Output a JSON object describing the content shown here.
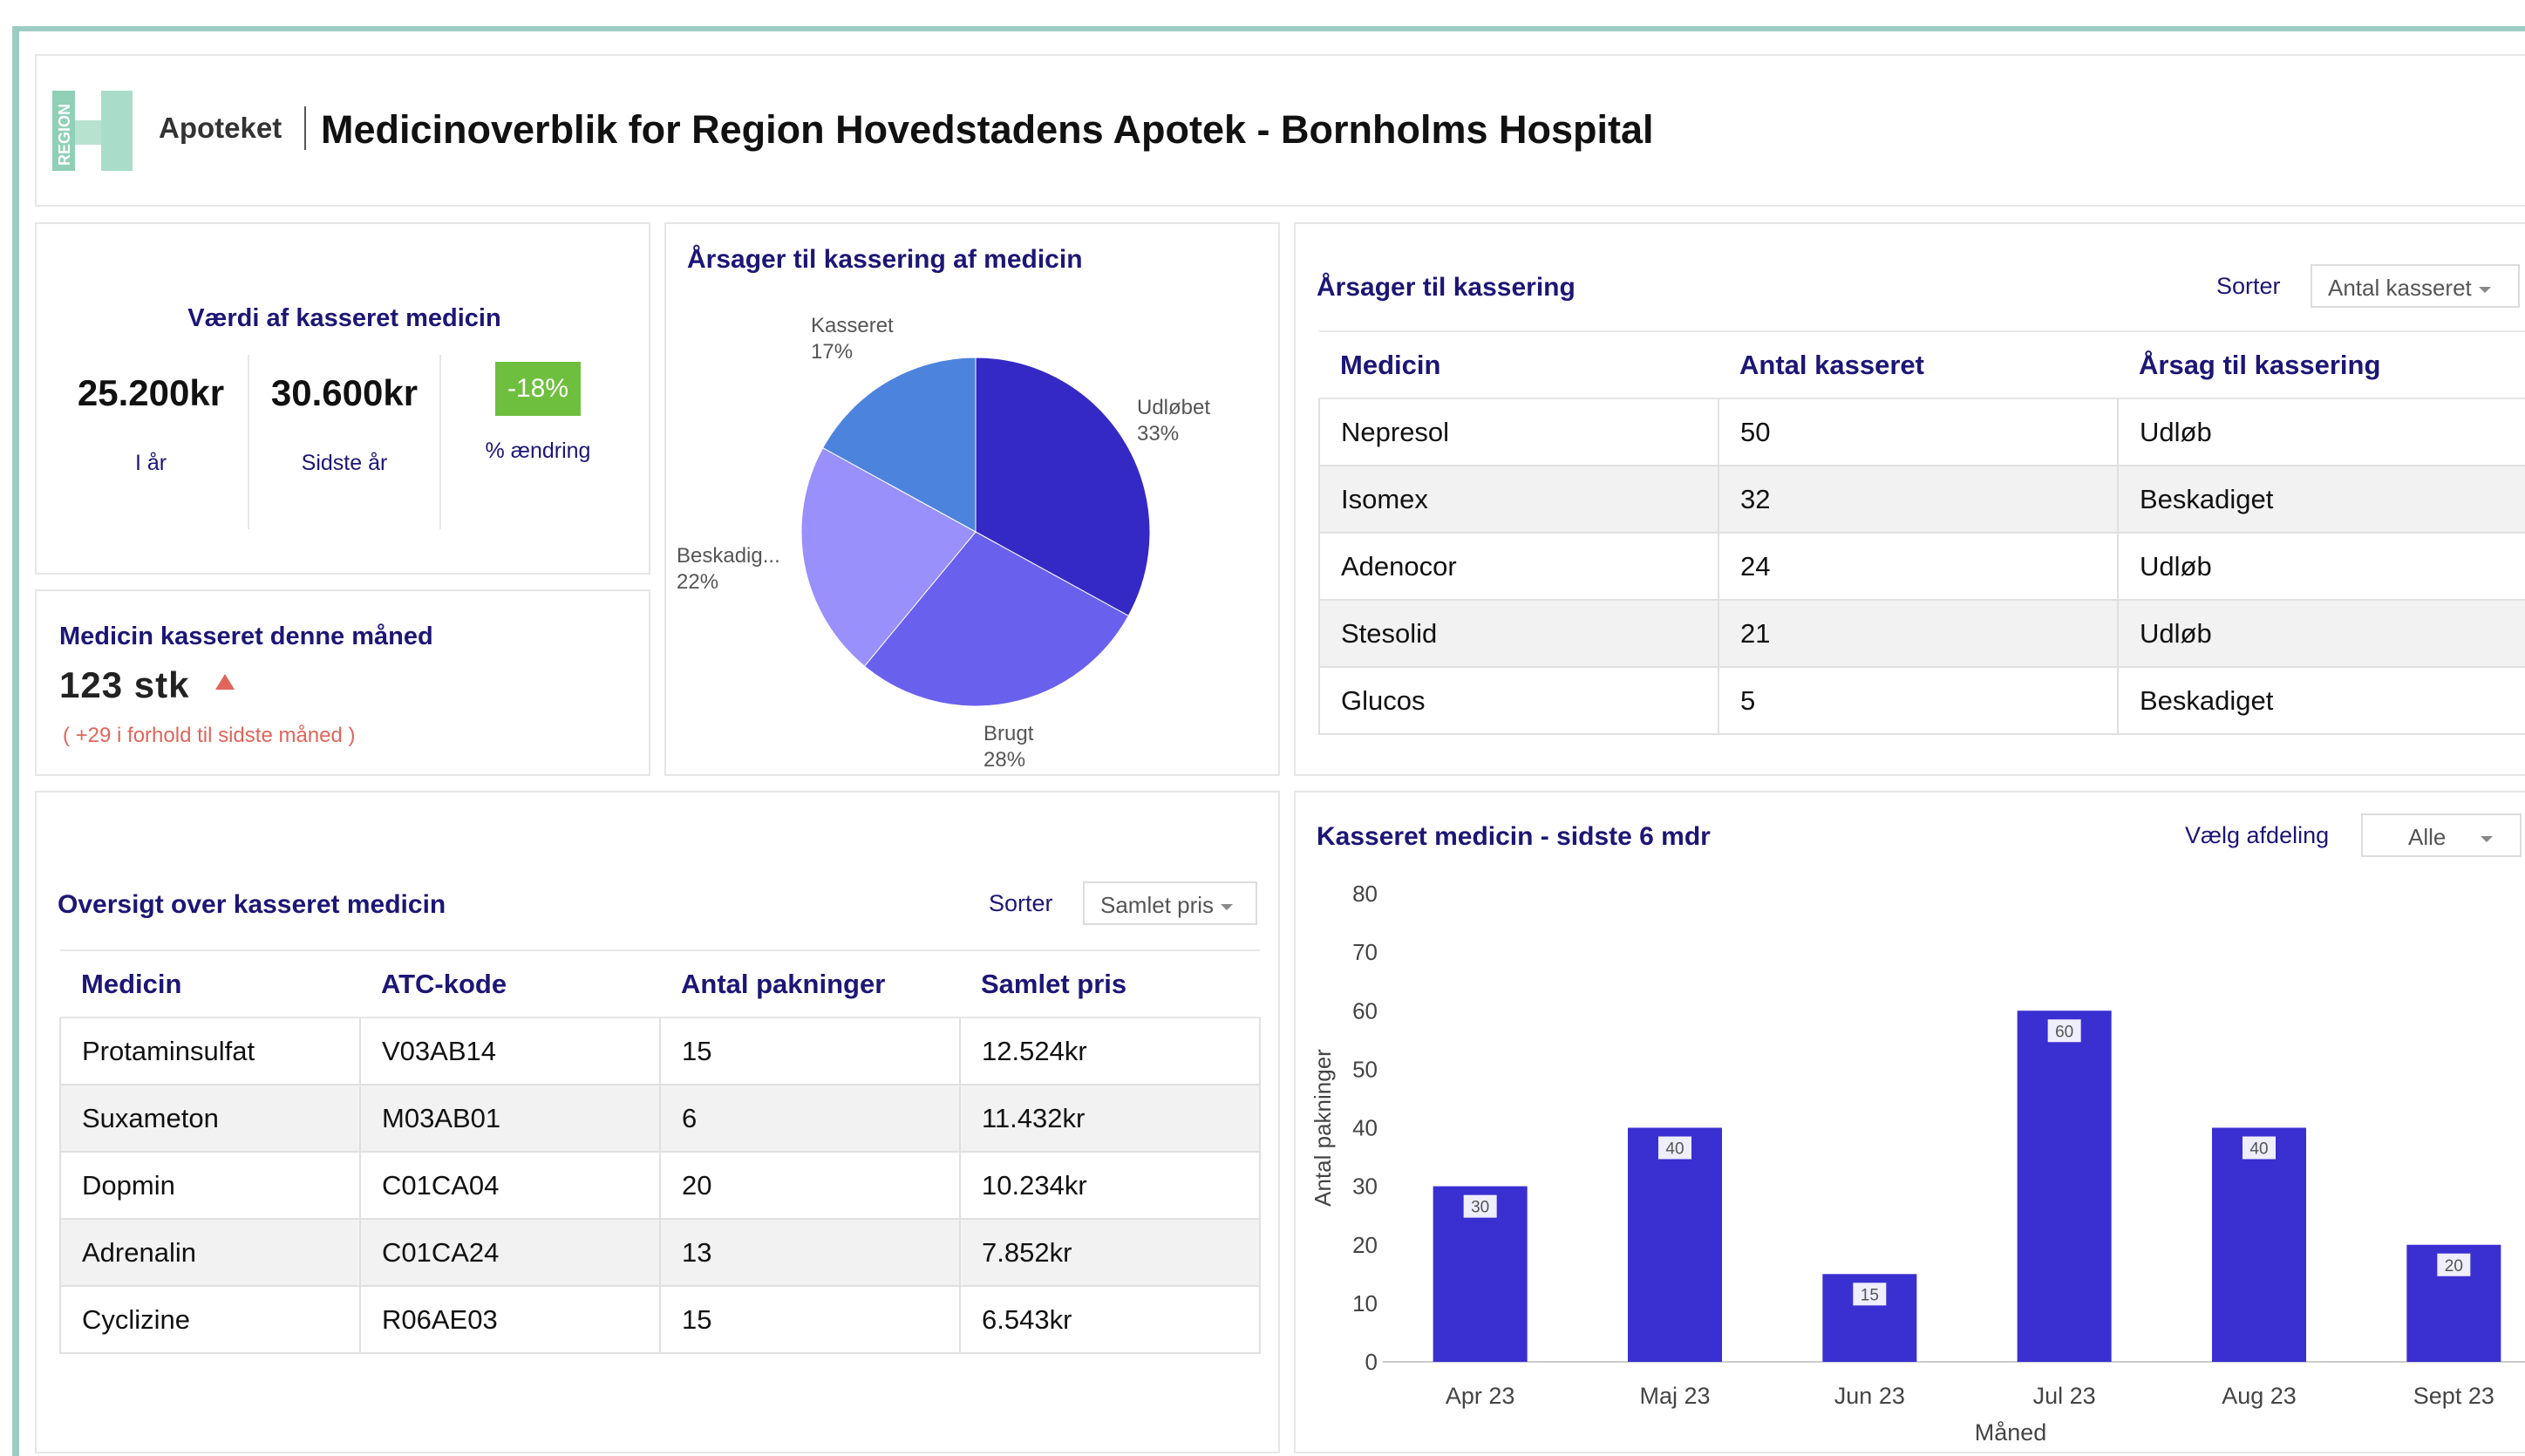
{
  "header": {
    "logo_text": "REGION",
    "app_name": "Apoteket",
    "title": "Medicinoverblik for Region Hovedstadens Apotek - Bornholms Hospital"
  },
  "colors": {
    "accent": "#1c1675",
    "bar": "#3a2fd0",
    "badge": "#6fbf3f",
    "alert": "#e0655a",
    "frame": "#9cccc3"
  },
  "kpi": {
    "title": "Værdi af kasseret medicin",
    "this_year_value": "25.200kr",
    "this_year_label": "I år",
    "last_year_value": "30.600kr",
    "last_year_label": "Sidste år",
    "change_value": "-18%",
    "change_label": "% ændring"
  },
  "month": {
    "title": "Medicin kasseret denne måned",
    "value": "123 stk",
    "note": "( +29 i forhold til sidste måned )",
    "trend": "up"
  },
  "pie": {
    "title": "Årsager til kassering af medicin",
    "slices": [
      {
        "label": "Udløbet",
        "percent_label": "33%",
        "value": 33,
        "color": "#3529c6"
      },
      {
        "label": "Brugt",
        "percent_label": "28%",
        "value": 28,
        "color": "#6a60ee"
      },
      {
        "label": "Beskadig...",
        "percent_label": "22%",
        "value": 22,
        "color": "#9990fb"
      },
      {
        "label": "Kasseret",
        "percent_label": "17%",
        "value": 17,
        "color": "#4c84dd"
      }
    ]
  },
  "reasons": {
    "title": "Årsager til kassering",
    "sort_label": "Sorter",
    "sort_value": "Antal kasseret",
    "columns": [
      "Medicin",
      "Antal kasseret",
      "Årsag til kassering"
    ],
    "rows": [
      [
        "Nepresol",
        "50",
        "Udløb"
      ],
      [
        "Isomex",
        "32",
        "Beskadiget"
      ],
      [
        "Adenocor",
        "24",
        "Udløb"
      ],
      [
        "Stesolid",
        "21",
        "Udløb"
      ],
      [
        "Glucos",
        "5",
        "Beskadiget"
      ]
    ]
  },
  "overview": {
    "title": "Oversigt over kasseret medicin",
    "sort_label": "Sorter",
    "sort_value": "Samlet pris",
    "columns": [
      "Medicin",
      "ATC-kode",
      "Antal pakninger",
      "Samlet pris"
    ],
    "rows": [
      [
        "Protaminsulfat",
        "V03AB14",
        "15",
        "12.524kr"
      ],
      [
        "Suxameton",
        "M03AB01",
        "6",
        "11.432kr"
      ],
      [
        "Dopmin",
        "C01CA04",
        "20",
        "10.234kr"
      ],
      [
        "Adrenalin",
        "C01CA24",
        "13",
        "7.852kr"
      ],
      [
        "Cyclizine",
        "R06AE03",
        "15",
        "6.543kr"
      ]
    ]
  },
  "bar_panel": {
    "title": "Kasseret medicin - sidste 6 mdr",
    "filter_label": "Vælg afdeling",
    "filter_value": "Alle"
  },
  "chart_data": {
    "type": "bar",
    "categories": [
      "Apr 23",
      "Maj 23",
      "Jun 23",
      "Jul 23",
      "Aug 23",
      "Sept 23"
    ],
    "values": [
      30,
      40,
      15,
      60,
      40,
      20
    ],
    "xlabel": "Måned",
    "ylabel": "Antal pakninger",
    "ylim": [
      0,
      80
    ],
    "yticks": [
      0,
      10,
      20,
      30,
      40,
      50,
      60,
      70,
      80
    ],
    "data_labels": true,
    "grid": false
  }
}
